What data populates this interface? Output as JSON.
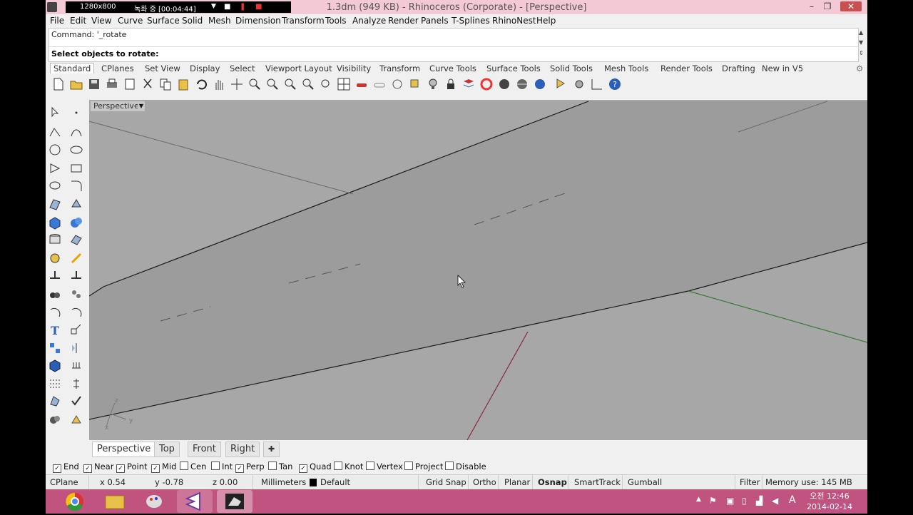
{
  "recorder": {
    "resolution": "1280x800",
    "status": "녹화 중 [00:04:44]"
  },
  "window": {
    "title": "1.3dm (949 KB) - Rhinoceros (Corporate) - [Perspective]"
  },
  "menu": [
    "File",
    "Edit",
    "View",
    "Curve",
    "Surface",
    "Solid",
    "Mesh",
    "Dimension",
    "Transform",
    "Tools",
    "Analyze",
    "Render",
    "Panels",
    "T-Splines",
    "RhinoNest",
    "Help"
  ],
  "command": {
    "history": "Command: '_rotate",
    "prompt": "Select objects to rotate:"
  },
  "toolbar_tabs": [
    "Standard",
    "CPlanes",
    "Set View",
    "Display",
    "Select",
    "Viewport Layout",
    "Visibility",
    "Transform",
    "Curve Tools",
    "Surface Tools",
    "Solid Tools",
    "Mesh Tools",
    "Render Tools",
    "Drafting",
    "New in V5"
  ],
  "viewport": {
    "label": "Perspective",
    "axis_z": "z",
    "axis_x": "x",
    "axis_y": "y"
  },
  "viewport_tabs": [
    "Perspective",
    "Top",
    "Front",
    "Right"
  ],
  "osnap": [
    {
      "label": "End",
      "checked": true
    },
    {
      "label": "Near",
      "checked": true
    },
    {
      "label": "Point",
      "checked": true
    },
    {
      "label": "Mid",
      "checked": true
    },
    {
      "label": "Cen",
      "checked": false
    },
    {
      "label": "Int",
      "checked": false
    },
    {
      "label": "Perp",
      "checked": true
    },
    {
      "label": "Tan",
      "checked": false
    },
    {
      "label": "Quad",
      "checked": true
    },
    {
      "label": "Knot",
      "checked": false
    },
    {
      "label": "Vertex",
      "checked": false
    },
    {
      "label": "Project",
      "checked": false
    },
    {
      "label": "Disable",
      "checked": false
    }
  ],
  "status": {
    "cplane": "CPlane",
    "x": "x 0.54",
    "y": "y -0.78",
    "z": "z 0.00",
    "units": "Millimeters",
    "layer": "Default",
    "grid_snap": "Grid Snap",
    "ortho": "Ortho",
    "planar": "Planar",
    "osnap": "Osnap",
    "smarttrack": "SmartTrack",
    "gumball": "Gumball",
    "filter": "Filter",
    "memory": "Memory use: 145 MB"
  },
  "tray": {
    "time": "오전 12:46",
    "date": "2014-02-14",
    "ime": "A"
  }
}
